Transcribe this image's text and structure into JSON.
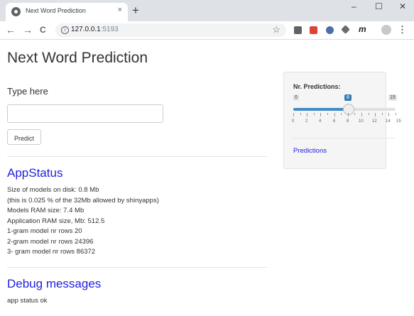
{
  "browser": {
    "tab_title": "Next Word Prediction",
    "tab_close": "×",
    "new_tab": "+",
    "win_min": "–",
    "win_max": "☐",
    "win_close": "✕",
    "back": "←",
    "forward": "→",
    "reload": "C",
    "url_host": "127.0.0.1",
    "url_port": ":5193",
    "info": "i",
    "star": "☆",
    "ext_m": "m",
    "menu": "⋮"
  },
  "page": {
    "title": "Next Word Prediction",
    "input_label": "Type here",
    "input_value": "",
    "predict_label": "Predict",
    "appstatus_title": "AppStatus",
    "status_lines": [
      "Size of models on disk: 0.8 Mb",
      "(this is 0.025 % of the 32Mb allowed by shinyapps)",
      "Models RAM size: 7.4 Mb",
      "Application RAM size, Mb: 512.5",
      "1-gram model nr rows 20",
      "2-gram model nr rows 24396",
      "3- gram model nr rows 86372"
    ],
    "debug_title": "Debug messages",
    "debug_text": "app status ok"
  },
  "sidebar": {
    "slider_label": "Nr. Predictions:",
    "slider_min": "0",
    "slider_max": "15",
    "slider_value": "8",
    "slider_fraction": 0.5333,
    "tick_labels": [
      "0",
      "2",
      "4",
      "6",
      "8",
      "10",
      "12",
      "14",
      "15"
    ],
    "link_label": "Predictions"
  },
  "colors": {
    "accent": "#337ab7",
    "heading": "#2020e0"
  }
}
